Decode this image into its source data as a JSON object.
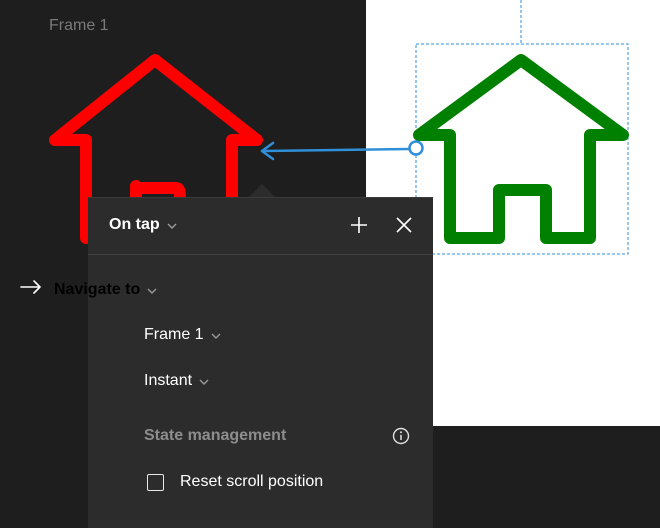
{
  "canvas": {
    "frame_label": "Frame 1",
    "colors": {
      "source_house": "#ff0000",
      "target_house": "#008000",
      "connector": "#2f8fd8",
      "selection": "#2f8fd8"
    }
  },
  "interaction_panel": {
    "trigger": "On tap",
    "add_icon": "plus-icon",
    "close_icon": "close-icon",
    "action": {
      "icon": "arrow-right-icon",
      "label": "Navigate to"
    },
    "destination": "Frame 1",
    "animation": "Instant",
    "state_management": {
      "heading": "State management",
      "info_icon": "info-icon"
    },
    "reset_scroll": {
      "label": "Reset scroll position",
      "checked": false
    }
  }
}
